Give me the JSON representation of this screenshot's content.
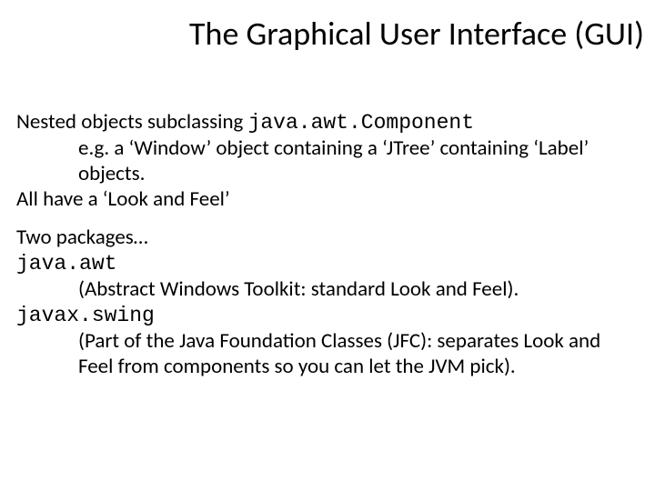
{
  "title": "The Graphical User Interface (GUI)",
  "p1_lead": "Nested objects subclassing ",
  "p1_code": "java.awt.Component",
  "p1_indent": "e.g. a ‘Window’ object containing a ‘JTree’ containing ‘Label’ objects.",
  "p1_tail": "All have a ‘Look and Feel’",
  "p2_lead": "Two packages…",
  "pkg1_code": "java.awt",
  "pkg1_desc": "(Abstract Windows Toolkit:  standard Look and Feel).",
  "pkg2_code": "javax.swing",
  "pkg2_desc": "(Part of the Java Foundation Classes (JFC): separates Look and Feel from components so you can let the JVM pick)."
}
